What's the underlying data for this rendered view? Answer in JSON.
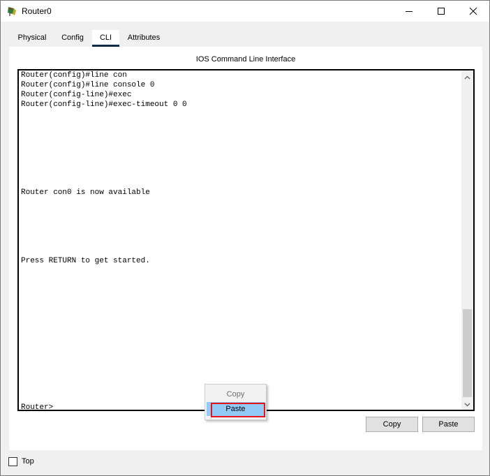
{
  "window": {
    "title": "Router0",
    "icon": "router-icon"
  },
  "tabs": [
    {
      "label": "Physical",
      "active": false
    },
    {
      "label": "Config",
      "active": false
    },
    {
      "label": "CLI",
      "active": true
    },
    {
      "label": "Attributes",
      "active": false
    }
  ],
  "cli": {
    "heading": "IOS Command Line Interface",
    "lines": [
      "Router(config)#line con",
      "Router(config)#line console 0",
      "Router(config-line)#exec",
      "Router(config-line)#exec-timeout 0 0",
      "",
      "",
      "",
      "",
      "",
      "",
      "",
      "",
      "Router con0 is now available",
      "",
      "",
      "",
      "",
      "",
      "",
      "Press RETURN to get started.",
      "",
      "",
      "",
      "",
      "",
      "",
      "",
      "",
      "",
      "",
      "",
      "",
      "",
      "",
      "Router>",
      "Router>"
    ]
  },
  "context_menu": {
    "items": [
      {
        "label": "Copy",
        "enabled": false
      },
      {
        "label": "Paste",
        "enabled": true
      }
    ]
  },
  "buttons": {
    "copy": "Copy",
    "paste": "Paste"
  },
  "footer": {
    "top_label": "Top",
    "top_checked": false
  },
  "colors": {
    "tab_underline": "#0e2a47",
    "menu_hover": "#91c9f7",
    "highlight_border": "#e4141a"
  }
}
